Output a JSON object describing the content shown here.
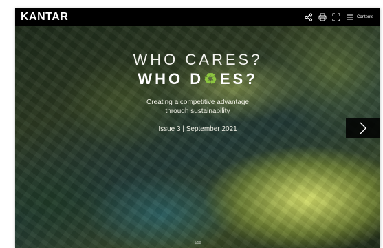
{
  "brand": {
    "logo_text": "KANTAR"
  },
  "toolbar": {
    "icons": [
      "share-icon",
      "print-icon",
      "fullscreen-icon",
      "menu-icon"
    ],
    "contents_label": "Contents"
  },
  "cover": {
    "title_line1": "WHO CARES?",
    "title_line2_start": "WHO D",
    "title_line2_leaf": "♻",
    "title_line2_end": "ES?",
    "subtitle_line1": "Creating a competitive advantage",
    "subtitle_line2": "through sustainability",
    "issue": "Issue 3 | September 2021",
    "page_number": "1/58"
  },
  "navigation": {
    "next_icon": "chevron-right-icon"
  },
  "colors": {
    "topbar": "#000000",
    "leaf_accent": "#8cc63f",
    "text": "#ffffff"
  }
}
